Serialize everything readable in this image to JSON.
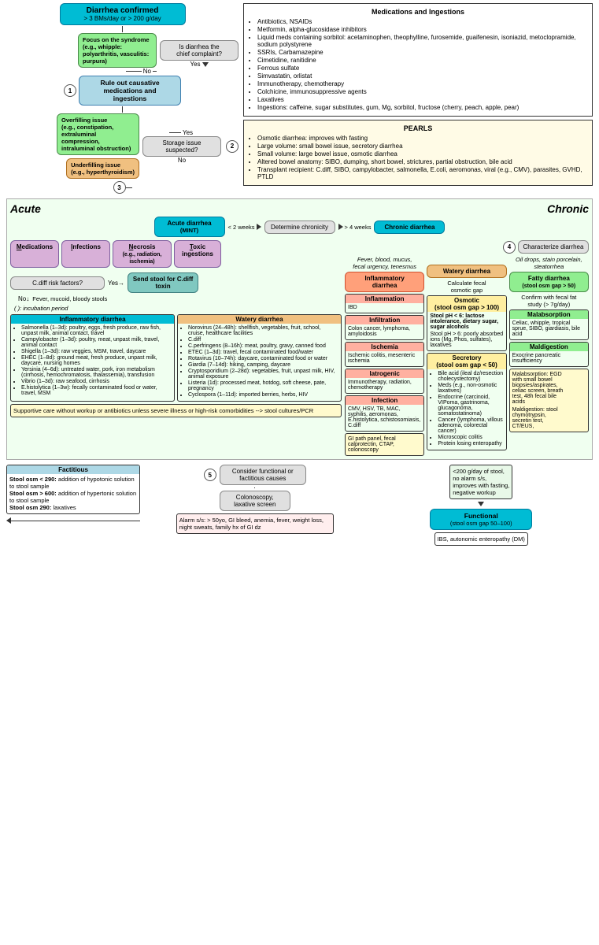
{
  "header": {
    "diarrhea_confirmed": "Diarrhea confirmed",
    "diarrhea_criteria": "> 3 BMs/day or > 200 g/day",
    "meds_title": "Medications and Ingestions",
    "meds_items": [
      "Antibiotics, NSAIDs",
      "Metformin, alpha-glucosidase inhibitors",
      "Liquid meds containing sorbitol: acetaminophen, theophylline, furosemide, guaifenesin, isoniazid, metoclopramide, sodium polystyrene",
      "SSRIs, Carbamazepine",
      "Cimetidine, ranitidine",
      "Ferrous sulfate",
      "Simvastatin, orlistat",
      "Immunotherapy, chemotherapy",
      "Colchicine, immunosuppressive agents",
      "Laxatives",
      "Ingestions: caffeine, sugar substitutes, gum, Mg, sorbitol, fructose (cherry, peach, apple, pear)"
    ],
    "pearls_title": "PEARLS",
    "pearls_items": [
      "Osmotic diarrhea: improves with fasting",
      "Large volume: small bowel issue, secretory diarrhea",
      "Small volume: large bowel issue, osmotic diarrhea",
      "Altered bowel anatomy: SIBO, dumping, short bowel, strictures, partial obstruction, bile acid",
      "Transplant recipient: C.diff, SIBO, campylobacter, salmonella, E.coli, aeromonas, viral (e.g., CMV), parasites, GVHD, PTLD"
    ]
  },
  "flow": {
    "is_diarrhea_chief": "Is diarrhea the\nchief complaint?",
    "focus_syndrome": "Focus on the syndrome\n(e.g., whipple: polyarthritis,\nvasculitis: purpura)",
    "rule_out_label": "Rule out causative\nmedications and\ningestions",
    "storage_issue": "Storage issue\nsuspected?",
    "overfilling": "Overfilling issue\n(e.g., constipation, extraluminal\ncompression, intraluminal\nobstruction)",
    "underfilling": "Underfilling issue\n(e.g., hyperthyroidism)",
    "determine_chronicity": "Determine chronicity",
    "acute_label": "Acute",
    "chronic_label": "Chronic",
    "less_2_weeks": "< 2 weeks",
    "more_4_weeks": "> 4 weeks",
    "acute_diarrhea": "Acute diarrhea\n(MINT)",
    "chronic_diarrhea": "Chronic diarrhea",
    "characterize_diarrhea": "Characterize\ndiarrhea",
    "step1": "1",
    "step2": "2",
    "step3": "3",
    "step4": "4",
    "step5": "5",
    "yes": "Yes",
    "no": "No"
  },
  "acute_causes": {
    "medications": "Medications",
    "infections": "Infections",
    "necrosis": "Necrosis\n(e.g., radiation,\nischemia)",
    "toxic": "Toxic\ningestions",
    "cdiff_risk": "C.diff risk factors?",
    "send_stool": "Send stool for\nC.diff toxin",
    "fever_mucoid": "Fever, mucoid, bloody stools",
    "incubation": "( ): incubation\nperiod"
  },
  "inflammatory_diarrhea_box": {
    "title": "Inflammatory diarrhea",
    "items": [
      "Salmonella (1–3d): poultry, eggs, fresh produce, raw fish, unpast milk, animal contact, travel",
      "Campylobacter (1–3d): poultry, meat, unpast milk, travel, animal contact",
      "Shigella (1–3d): raw veggies, MSM, travel, daycare",
      "EHEC (1–8d): ground meat, fresh produce, unpast milk, daycare, nursing homes",
      "Yersinia (4–6d): untreated water, pork, iron metabolism (cirrhosis, hemochromatosis, thalassemia), transfusion",
      "Vibrio (1–3d): raw seafood, cirrhosis",
      "E.histolytica (1–3w): fecally contaminated food or water, travel, MSM"
    ]
  },
  "watery_diarrhea_box": {
    "title": "Watery diarrhea",
    "items": [
      "Norovirus (24–48h): shellfish, vegetables, fruit, school, cruise, healthcare facilities",
      "C.diff",
      "C.perfringens (8–16h): meat, poultry, gravy, canned food",
      "ETEC (1–3d): travel, fecal contaminated food/water",
      "Rotavirus (10–74h): daycare, contaminated food or water",
      "Giardia (7–14d): hiking, camping, daycare",
      "Cryptosporidium (2–28d): vegetables, fruit, unpast milk, HIV, animal exposure",
      "Listeria (1d): processed meat, hotdog, soft cheese, pate, pregnancy",
      "Cyclospora (1–11d): imported berries, herbs, HIV"
    ]
  },
  "supportive_care": "Supportive care without workup or antibiotics unless severe illness or high-risk comorbidities --> stool cultures/PCR",
  "chronic_types": {
    "inflammatory": {
      "title": "Inflammatory\ndiarrhea",
      "trigger": "Fever, blood, mucus,\nfecal urgency, tenesmus",
      "inflammation": {
        "title": "Inflammation",
        "body": "IBD"
      },
      "infiltration": {
        "title": "Infiltration",
        "body": "Colon cancer,\nlymphoma,\namyloidosis"
      },
      "ischemia": {
        "title": "Ischemia",
        "body": "Ischemic colitis,\nmesenteric ischemia"
      },
      "iatrogenic": {
        "title": "Iatrogenic",
        "body": "Immunotherapy,\nradiation,\nchemotherapy"
      },
      "infection": {
        "title": "Infection",
        "body": "CMV, HSV, TB, MAC,\nsyphilis, aeromonas,\nE.histolytica,\nschistosomiasis,\nC.diff"
      },
      "workup": "GI path panel, fecal\ncalprotectin, CTAP,\ncolonoscopy"
    },
    "watery": {
      "title": "Watery diarrhea",
      "osmotic_title": "Osmotic\n(stool osm gap > 100)",
      "osmotic_ph_low": "Stool pH < 6: lactose\nintolerance, dietary\nsugar, sugar alcohols",
      "osmotic_ph_high": "Stool pH > 6: poorly\nabsorbed ions (Mg,\nPhos, sulfates),\nlaxatives",
      "secretory_title": "Secretory\n(stool osm gap < 50)",
      "secretory_items": [
        "Bile acid (ileal dz/resection cholecystectomy)",
        "Meds (e.g., non-osmotic laxatives)",
        "Endocrine (carcinoid, VIPoma, gastrinoma, glucagonoma, somatostatinoma)",
        "Cancer (lymphoma, villous adenoma, colorectal cancer)",
        "Microscopic colitis",
        "Protein losing enteropathy"
      ],
      "calc_fecal_osmotic": "Calculate fecal\nosmotic gap"
    },
    "fatty": {
      "title": "Fatty diarrhea\n(stool osm gap > 50)",
      "trigger": "Oil drops, stain porcelain,\nsteatorrhea",
      "confirm": "Confirm with fecal fat\nstudy (> 7g/day)",
      "malabsorption_title": "Malabsorption",
      "malabsorption_body": "Celiac, whipple,\ntropical sprue, SIBO,\ngiardiasis, bile acid",
      "maldigestion_title": "Maldigestion",
      "maldigestion_body": "Exocrine pancreatic\ninsufficiency",
      "malabsorption_workup": "Malabsorption: EGD\nwith small bowel\nbiopsies/aspirates,\nceliac screen, breath\ntest, 48h fecal bile\nacids",
      "maldigestion_workup": "Maldigestion: stool\nchymotrypsin,\nsecretin test,\nCT/EUS,"
    }
  },
  "bottom": {
    "step5_label": "Consider functional or\nfactitious causes",
    "factitious_title": "Factitious",
    "factitious_body": "Stool osm < 290: addition of\nhypotonic solution to stool sample\nStool osm > 600: addition of\nhypertonic solution to stool sample\nStool osm 290: laxatives",
    "colonoscopy": "Colonoscopy,\nlaxative screen",
    "condition": "<200 g/day of stool,\nno alarm s/s,\nimproves with fasting,\nnegative workup",
    "alarm_ss": "Alarm s/s: > 50yo, GI bleed,\nanemia, fever, weight loss, night\nsweats, family hx of GI dz",
    "functional_title": "Functional\n(stool osm gap 50–100)",
    "functional_body": "IBS, autonomic\nenteropathy (DM)"
  }
}
